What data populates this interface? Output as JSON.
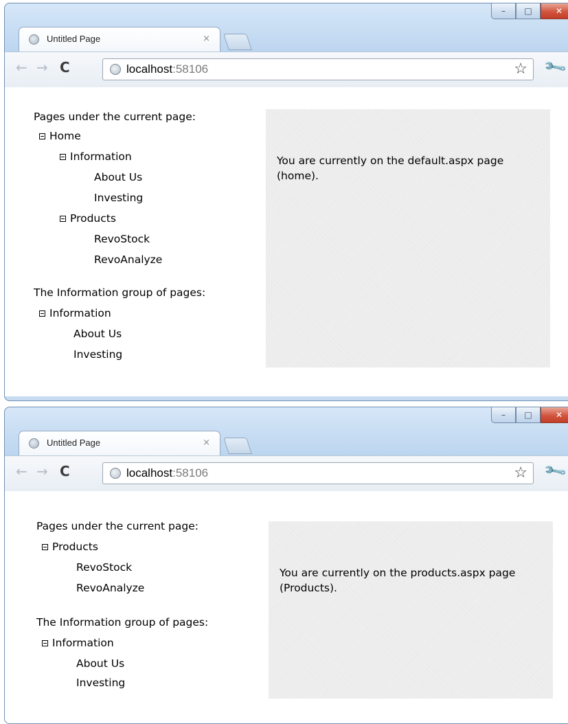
{
  "windows": [
    {
      "tab": {
        "title": "Untitled Page",
        "close": "×"
      },
      "address": {
        "host": "localhost",
        "port": ":58106"
      },
      "sections": [
        {
          "title": "Pages under the current page:",
          "tree": [
            {
              "label": "Home",
              "level": 0,
              "expanded": true
            },
            {
              "label": "Information",
              "level": 1,
              "expanded": true
            },
            {
              "label": "About Us",
              "level": 2
            },
            {
              "label": "Investing",
              "level": 2
            },
            {
              "label": "Products",
              "level": 1,
              "expanded": true
            },
            {
              "label": "RevoStock",
              "level": 2
            },
            {
              "label": "RevoAnalyze",
              "level": 2
            }
          ]
        },
        {
          "title": "The Information group of pages:",
          "tree": [
            {
              "label": "Information",
              "level": 0,
              "expanded": true
            },
            {
              "label": "About Us",
              "level": 1
            },
            {
              "label": "Investing",
              "level": 1
            }
          ]
        }
      ],
      "panel_text": "You are currently on the default.aspx page (home)."
    },
    {
      "tab": {
        "title": "Untitled Page",
        "close": "×"
      },
      "address": {
        "host": "localhost",
        "port": ":58106"
      },
      "sections": [
        {
          "title": "Pages under the current page:",
          "tree": [
            {
              "label": "Products",
              "level": 0,
              "expanded": true
            },
            {
              "label": "RevoStock",
              "level": 1
            },
            {
              "label": "RevoAnalyze",
              "level": 1
            }
          ]
        },
        {
          "title": "The Information group of pages:",
          "tree": [
            {
              "label": "Information",
              "level": 0,
              "expanded": true
            },
            {
              "label": "About Us",
              "level": 1
            },
            {
              "label": "Investing",
              "level": 1
            }
          ]
        }
      ],
      "panel_text": "You are currently on the products.aspx page (Products)."
    }
  ]
}
